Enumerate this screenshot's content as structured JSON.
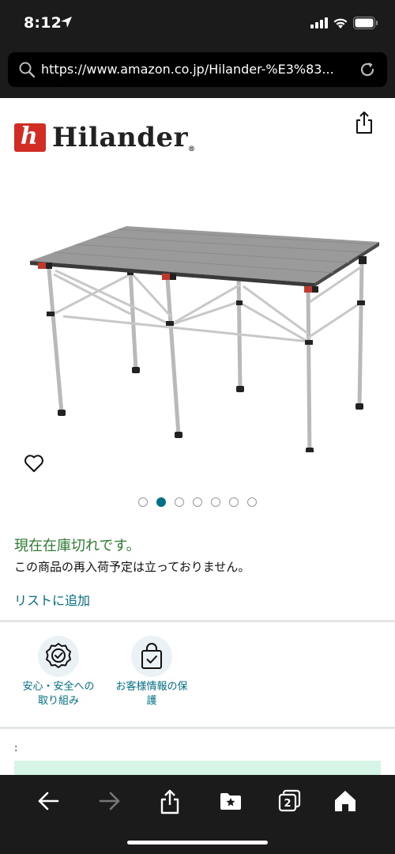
{
  "status_bar": {
    "time": "8:12"
  },
  "browser": {
    "url": "https://www.amazon.co.jp/Hilander-%E3%83...",
    "icons": [
      "search-icon",
      "reload-icon"
    ]
  },
  "brand": {
    "mark": "h",
    "name": "Hilander",
    "reg": "®"
  },
  "gallery": {
    "image_count": 7,
    "active_index": 1
  },
  "availability": {
    "status": "現在在庫切れです。",
    "note": "この商品の再入荷予定は立っておりません。"
  },
  "list_add_label": "リストに追加",
  "badges": [
    {
      "label_line1": "安心・安全への",
      "label_line2": "取り組み",
      "icon": "safety-badge-icon"
    },
    {
      "label_line1": "お客様情報の保",
      "label_line2": "護",
      "icon": "secure-bag-icon"
    }
  ],
  "misc": {
    "colon": ":"
  },
  "toolbar": {
    "icons": [
      "back-icon",
      "forward-icon",
      "share-icon",
      "bookmarks-icon",
      "tabs-icon",
      "home-icon"
    ],
    "tabs_count": "2"
  },
  "colors": {
    "accent_link": "#007185",
    "stock_green": "#2e7d32",
    "brand_red": "#d12d24",
    "chrome_dark": "#1b1b1b"
  }
}
